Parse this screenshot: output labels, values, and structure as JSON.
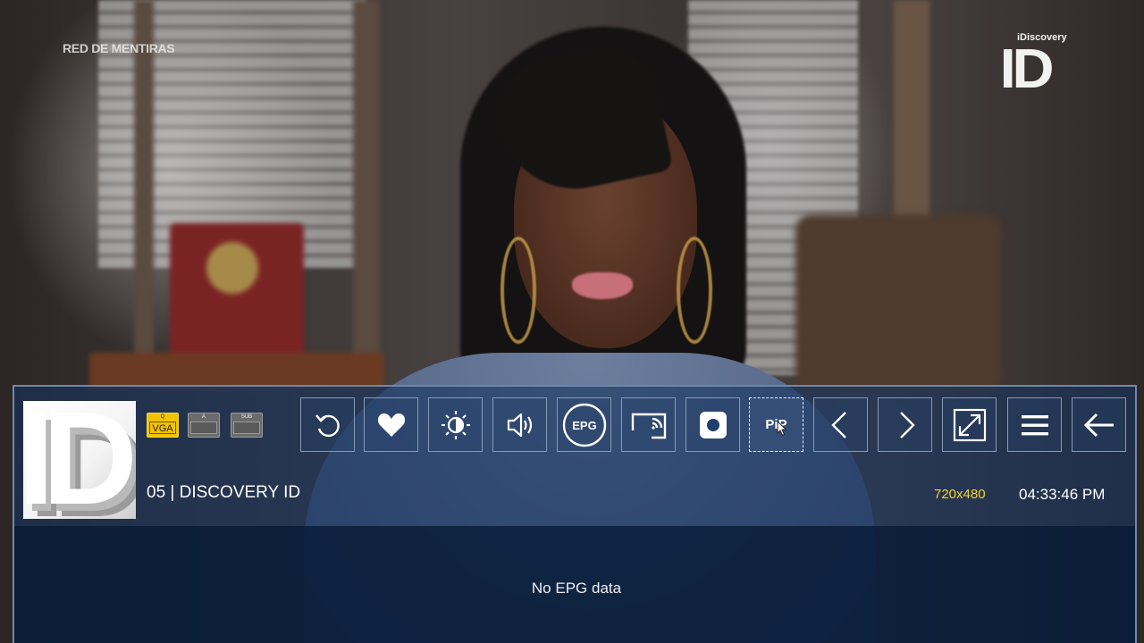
{
  "video": {
    "osd_channel_name": "RED DE MENTIRAS",
    "logo_small": "iDiscovery",
    "logo_big": "ID"
  },
  "player": {
    "channel_logo_text": "ID",
    "tracks": {
      "video": {
        "top": "Q",
        "label": "VGA"
      },
      "audio": {
        "top": "A",
        "label": ""
      },
      "subtitle": {
        "top": "SUB",
        "label": ""
      }
    },
    "controls": [
      {
        "name": "replay",
        "icon": "replay-icon"
      },
      {
        "name": "favorite",
        "icon": "heart-icon"
      },
      {
        "name": "brightness",
        "icon": "brightness-icon"
      },
      {
        "name": "volume",
        "icon": "speaker-icon"
      },
      {
        "name": "epg",
        "icon": "epg-icon",
        "label": "EPG"
      },
      {
        "name": "cast",
        "icon": "cast-icon"
      },
      {
        "name": "record",
        "icon": "record-icon"
      },
      {
        "name": "pip",
        "icon": "pip-icon",
        "label": "PiP"
      },
      {
        "name": "previous",
        "icon": "chevron-left-icon"
      },
      {
        "name": "next",
        "icon": "chevron-right-icon"
      },
      {
        "name": "fullscreen",
        "icon": "expand-icon"
      },
      {
        "name": "menu",
        "icon": "hamburger-icon"
      },
      {
        "name": "back",
        "icon": "arrow-left-icon"
      }
    ],
    "channel_title": "05 | DISCOVERY ID",
    "resolution": "720x480",
    "clock": "04:33:46 PM",
    "epg_message": "No EPG data"
  },
  "colors": {
    "panel": "#163460",
    "accent_yellow": "#f5d130",
    "video_badge": "#f2c200"
  }
}
